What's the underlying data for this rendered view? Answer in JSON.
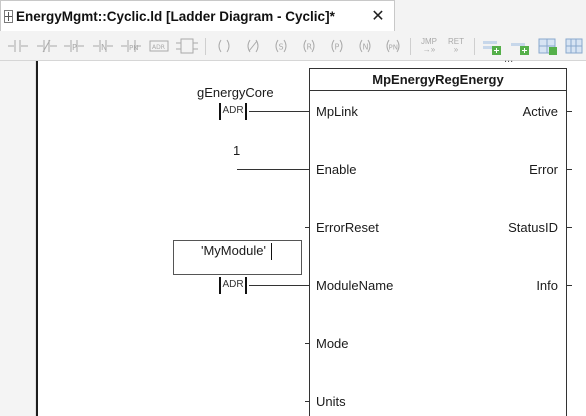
{
  "tab": {
    "title": "EnergyMgmt::Cyclic.ld [Ladder Diagram - Cyclic]*",
    "close": "✕"
  },
  "toolbar": {
    "jump": "JMP",
    "ret": "RET",
    "icons": [
      "contact-no-icon",
      "contact-nc-icon",
      "contact-p-icon",
      "contact-n-icon",
      "contact-pn-icon",
      "adr-icon",
      "block-icon",
      "coil-icon",
      "coil-negated-icon",
      "coil-set-icon",
      "coil-reset-icon",
      "coil-p-icon",
      "coil-n-icon",
      "coil-pn-icon",
      "jump-icon",
      "return-icon",
      "add-network-icon",
      "add-network-below-icon",
      "grid-icon",
      "grid-large-icon"
    ]
  },
  "block": {
    "name": "MpEnergyRegEnergy",
    "top_label": "...",
    "inputs": [
      "MpLink",
      "Enable",
      "ErrorReset",
      "ModuleName",
      "Mode",
      "Units"
    ],
    "outputs": [
      "Active",
      "Error",
      "StatusID",
      "Info"
    ]
  },
  "connections": {
    "mplink_var": "gEnergyCore",
    "adr": "ADR",
    "enable_value": "1",
    "module_name_value": "'MyModule'"
  },
  "colors": {
    "accent": "#1e1e1e",
    "toolbar_bg": "#f3f3f3",
    "gutter_bg": "#f4f4f4"
  }
}
